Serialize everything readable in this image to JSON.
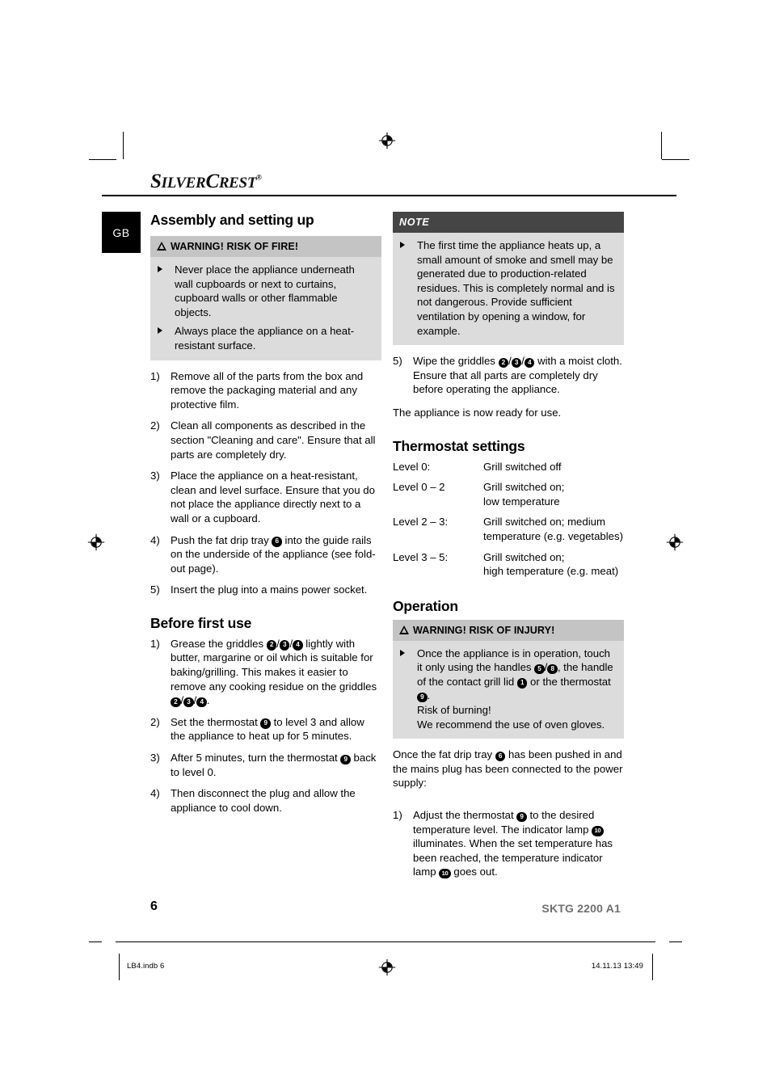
{
  "header": {
    "brand_primary": "S",
    "brand_rest_1": "ILVER",
    "brand_primary_2": "C",
    "brand_rest_2": "REST",
    "brand_registered": "®",
    "language_tab": "GB"
  },
  "left_column": {
    "section_title": "Assembly and setting up",
    "warning": {
      "caption": "WARNING! RISK OF FIRE!",
      "bullets": [
        "Never place the appliance underneath wall cupboards or next to curtains, cupboard walls or other flammable objects.",
        "Always place the appliance on a heat-resistant surface."
      ]
    },
    "steps": [
      {
        "num": "1)",
        "text": "Remove all of the parts from the box and remove the packaging material and any protective film."
      },
      {
        "num": "2)",
        "text": "Clean all components as described in the section \"Cleaning and care\". Ensure that all parts are completely dry."
      },
      {
        "num": "3)",
        "text": "Place the appliance on a heat-resistant, clean and level surface. Ensure that you do not place the appliance directly next to a wall or a cupboard."
      },
      {
        "num": "4)",
        "pre": "Push the fat drip tray ",
        "ref": "6",
        "post": " into the guide rails on the underside of the appliance (see fold-out page)."
      },
      {
        "num": "5)",
        "text": "Insert the plug into a mains power socket."
      }
    ],
    "before_first_use": {
      "title": "Before first use",
      "step1": {
        "num": "1)",
        "p1": "Grease the griddles ",
        "r1": "2",
        "s1": "/",
        "r2": "3",
        "s2": "/",
        "r3": "4",
        "p2": " lightly with butter, margarine or oil which is suitable for baking/grilling. This makes it easier to remove any cooking residue on the griddles ",
        "r4": "2",
        "s3": "/",
        "r5": "3",
        "s4": "/",
        "r6": "4",
        "p3": "."
      },
      "step2": {
        "num": "2)",
        "pre": "Set the thermostat ",
        "ref": "9",
        "post": " to level 3 and allow the appliance to heat up for 5 minutes."
      },
      "step3": {
        "num": "3)",
        "pre": "After 5 minutes, turn the thermostat ",
        "ref": "9",
        "post": " back to level 0."
      },
      "step4": {
        "num": "4)",
        "text": "Then disconnect the plug and allow the appliance to cool down."
      }
    }
  },
  "right_column": {
    "note": {
      "caption": "NOTE",
      "bullet": "The first time the appliance heats up, a small amount of smoke and smell may be generated due to production-related residues. This is completely normal and is not dangerous. Provide sufficient ventilation by opening a window, for example."
    },
    "step5": {
      "num": "5)",
      "pre": "Wipe the griddles ",
      "r1": "2",
      "s1": "/",
      "r2": "3",
      "s2": "/",
      "r3": "4",
      "post": " with a moist cloth. Ensure that all parts are completely dry before operating the appliance."
    },
    "ready_text": "The appliance is now ready for use.",
    "thermostat": {
      "title": "Thermostat settings",
      "rows": [
        {
          "level": "Level 0:",
          "desc": "Grill switched off"
        },
        {
          "level": "Level 0 – 2",
          "desc": "Grill switched on;\nlow temperature"
        },
        {
          "level": "Level 2 – 3:",
          "desc": "Grill switched on; medium\ntemperature (e.g. vegetables)"
        },
        {
          "level": "Level 3 – 5:",
          "desc": "Grill switched on;\nhigh temperature (e.g. meat)"
        }
      ]
    },
    "operation": {
      "title": "Operation",
      "warning": {
        "caption": "WARNING! RISK OF INJURY!",
        "pre": "Once the appliance is in operation, touch it only using the handles ",
        "r1": "5",
        "s1": "/",
        "r2": "8",
        "mid": ", the handle of the contact grill lid ",
        "r3": "1",
        "mid2": " or the thermostat ",
        "r4": "9",
        "post": ".",
        "line2": "Risk of burning!",
        "line3": "We recommend the use of oven gloves."
      },
      "intro_pre": "Once the fat drip tray ",
      "intro_ref": "6",
      "intro_post": " has been pushed in and the mains plug has been connected to the power supply:",
      "step1": {
        "num": "1)",
        "pre": "Adjust the thermostat ",
        "r1": "9",
        "mid": " to the desired temperature level. The indicator lamp ",
        "r2": "10",
        "mid2": " illuminates. When the set temperature has been reached, the temperature indicator lamp ",
        "r3": "10",
        "post": " goes out."
      }
    }
  },
  "footer": {
    "page_number": "6",
    "model": "SKTG 2200 A1",
    "file_name": "LB4.indb   6",
    "timestamp": "14.11.13   13:49"
  }
}
